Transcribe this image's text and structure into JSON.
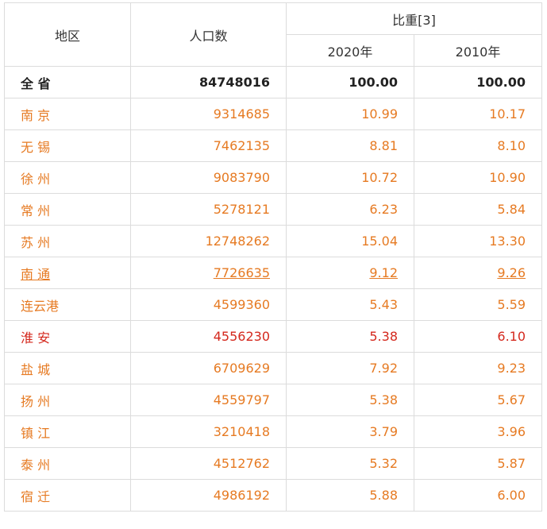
{
  "header": {
    "region": "地区",
    "population": "人口数",
    "share": "比重[3]",
    "year_2020": "2020年",
    "year_2010": "2010年"
  },
  "total": {
    "region": "全  省",
    "population": "84748016",
    "share_2020": "100.00",
    "share_2010": "100.00"
  },
  "rows": [
    {
      "region": "南  京",
      "population": "9314685",
      "share_2020": "10.99",
      "share_2010": "10.17",
      "style": "orange"
    },
    {
      "region": "无  锡",
      "population": "7462135",
      "share_2020": "8.81",
      "share_2010": "8.10",
      "style": "orange"
    },
    {
      "region": "徐  州",
      "population": "9083790",
      "share_2020": "10.72",
      "share_2010": "10.90",
      "style": "orange"
    },
    {
      "region": "常    州",
      "population": "5278121",
      "share_2020": "6.23",
      "share_2010": "5.84",
      "style": "orange"
    },
    {
      "region": "苏    州",
      "population": "12748262",
      "share_2020": "15.04",
      "share_2010": "13.30",
      "style": "orange"
    },
    {
      "region": "南    通",
      "population": "7726635",
      "share_2020": "9.12",
      "share_2010": "9.26",
      "style": "link"
    },
    {
      "region": "连云港",
      "population": "4599360",
      "share_2020": "5.43",
      "share_2010": "5.59",
      "style": "orange"
    },
    {
      "region": "淮    安",
      "population": "4556230",
      "share_2020": "5.38",
      "share_2010": "6.10",
      "style": "red"
    },
    {
      "region": "盐    城",
      "population": "6709629",
      "share_2020": "7.92",
      "share_2010": "9.23",
      "style": "orange"
    },
    {
      "region": "扬    州",
      "population": "4559797",
      "share_2020": "5.38",
      "share_2010": "5.67",
      "style": "orange"
    },
    {
      "region": "镇    江",
      "population": "3210418",
      "share_2020": "3.79",
      "share_2010": "3.96",
      "style": "orange"
    },
    {
      "region": "泰    州",
      "population": "4512762",
      "share_2020": "5.32",
      "share_2010": "5.87",
      "style": "orange"
    },
    {
      "region": "宿    迁",
      "population": "4986192",
      "share_2020": "5.88",
      "share_2010": "6.00",
      "style": "orange"
    }
  ],
  "colors": {
    "orange": "#e67a22",
    "red": "#d4281d",
    "text": "#333333",
    "border": "#dcdcdc"
  }
}
